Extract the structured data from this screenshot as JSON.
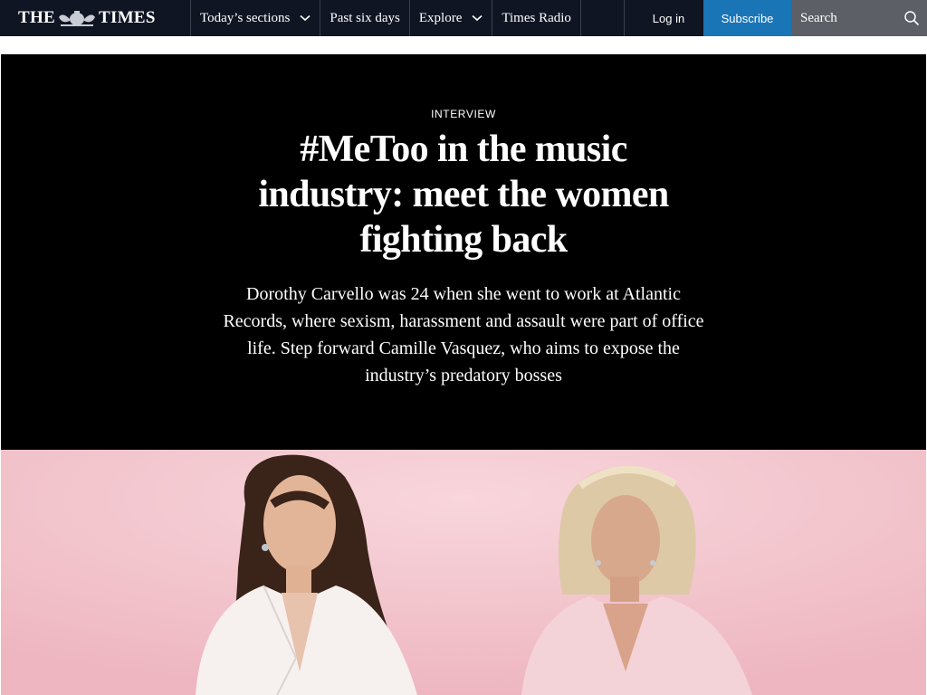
{
  "brand": {
    "word_left": "THE",
    "word_right": "TIMES"
  },
  "nav": {
    "items": [
      {
        "label": "Today’s sections",
        "has_dropdown": true
      },
      {
        "label": "Past six days",
        "has_dropdown": false
      },
      {
        "label": "Explore",
        "has_dropdown": true
      },
      {
        "label": "Times Radio",
        "has_dropdown": false
      }
    ],
    "login_label": "Log in",
    "subscribe_label": "Subscribe",
    "search_placeholder": "Search",
    "icons": {
      "dropdown": "chevron-down-icon",
      "search": "search-icon"
    }
  },
  "article": {
    "kicker": "INTERVIEW",
    "headline": "#MeToo in the music industry: meet the women fighting back",
    "standfirst": "Dorothy Carvello was 24 when she went to work at Atlantic Records, where sexism, harassment and assault were part of office life. Step forward Camille Vasquez, who aims to expose the industry’s predatory bosses"
  },
  "colors": {
    "nav_bg": "#0f1523",
    "subscribe_bg": "#1a75b6",
    "search_bg": "#5c5f66",
    "hero_bg": "#000000",
    "photo_bg": "#f4c8d0"
  }
}
